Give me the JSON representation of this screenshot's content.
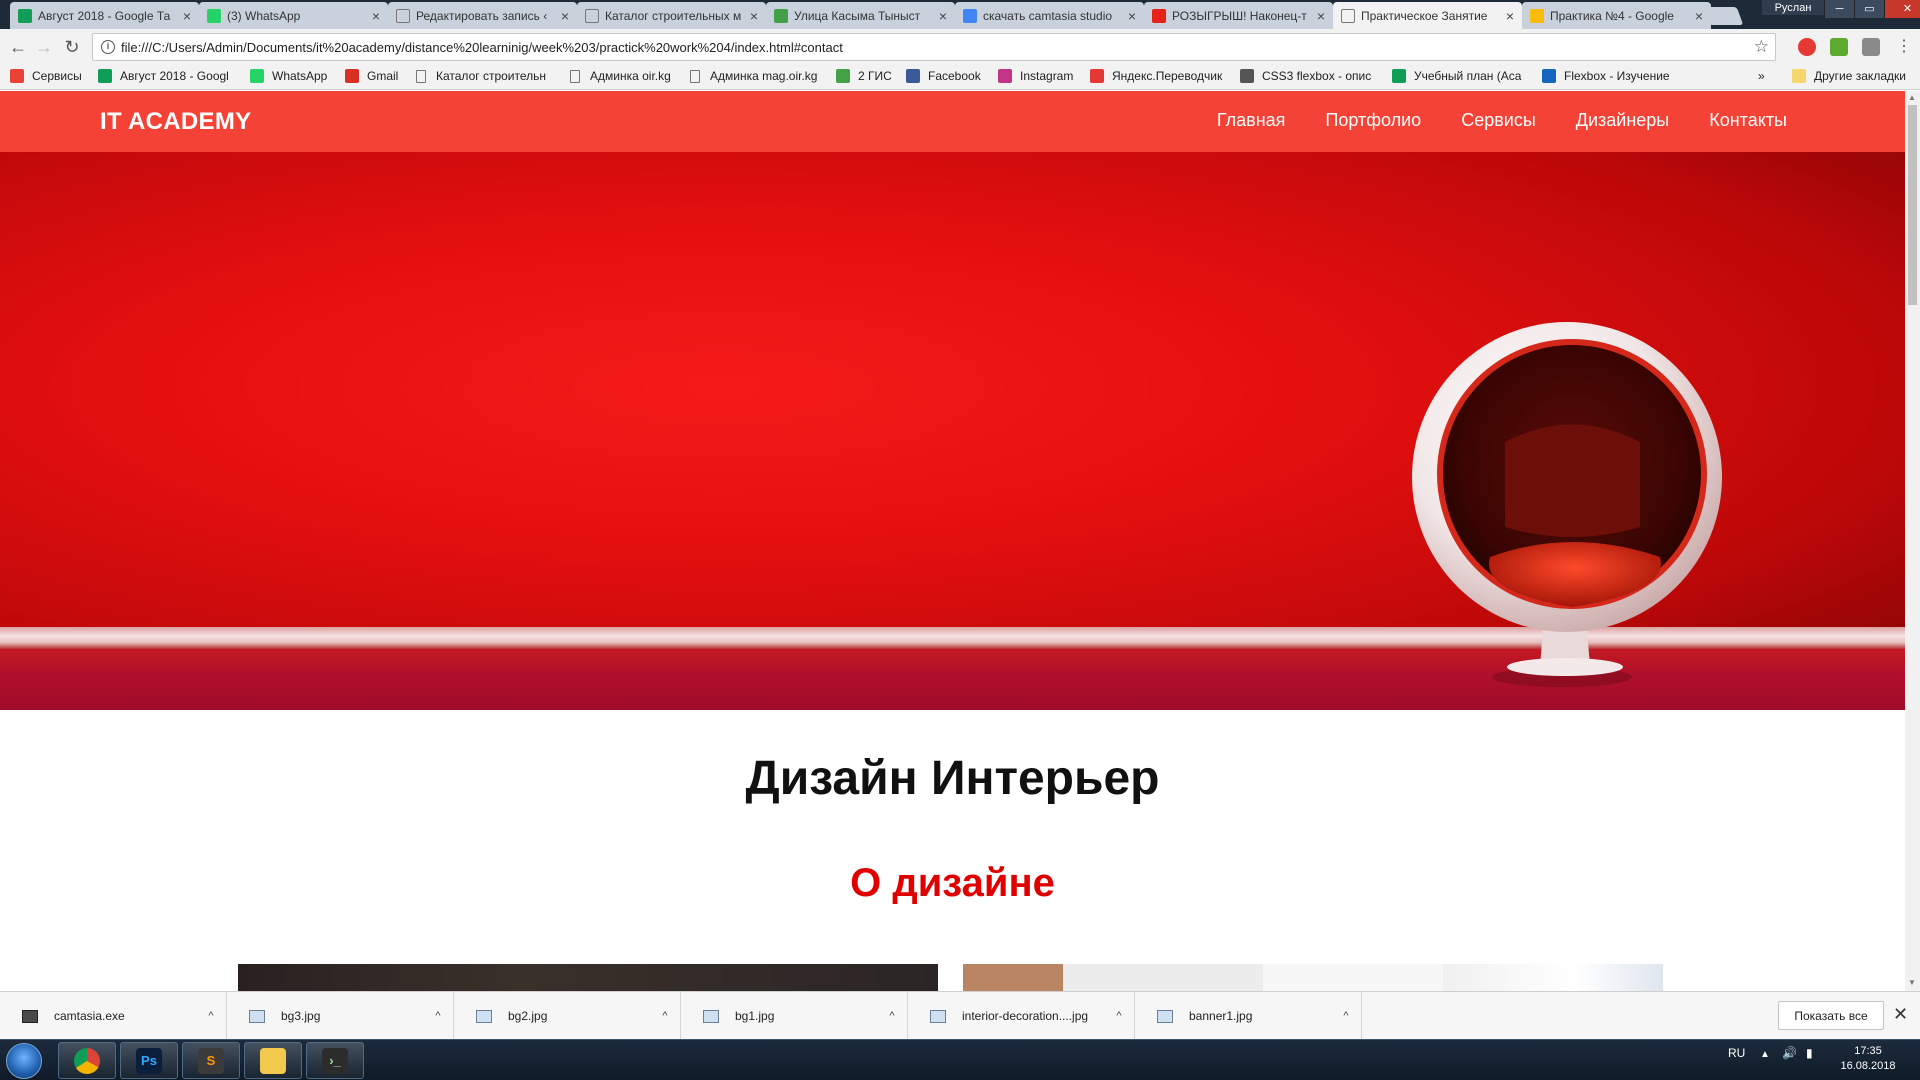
{
  "tabs": [
    {
      "title": "Август 2018 - Google Та",
      "icon": "sheets-icon",
      "color": "#0f9d58"
    },
    {
      "title": "(3) WhatsApp",
      "icon": "whatsapp-icon",
      "color": "#25d366"
    },
    {
      "title": "Редактировать запись ‹",
      "icon": "page-icon",
      "color": ""
    },
    {
      "title": "Каталог строительных м",
      "icon": "page-icon",
      "color": ""
    },
    {
      "title": "Улица Касыма Тыныст",
      "icon": "2gis-icon",
      "color": "#43a047"
    },
    {
      "title": "скачать camtasia studio",
      "icon": "google-icon",
      "color": "#4285f4"
    },
    {
      "title": "РОЗЫГРЫШ! Наконец-т",
      "icon": "youtube-icon",
      "color": "#e62117"
    },
    {
      "title": "Практическое Занятие",
      "icon": "page-icon",
      "color": "",
      "active": true
    },
    {
      "title": "Практика №4 - Google",
      "icon": "drive-icon",
      "color": "#fbbc05"
    }
  ],
  "window": {
    "user": "Руслан"
  },
  "address": {
    "url": "file:///C:/Users/Admin/Documents/it%20academy/distance%20learninig/week%203/practick%20work%204/index.html#contact"
  },
  "bookmarks": [
    {
      "label": "Сервисы",
      "icon": "apps-icon",
      "color": "#e94235"
    },
    {
      "label": "Август 2018 - Googl",
      "icon": "sheets-icon",
      "color": "#0f9d58"
    },
    {
      "label": "WhatsApp",
      "icon": "whatsapp-icon",
      "color": "#25d366"
    },
    {
      "label": "Gmail",
      "icon": "gmail-icon",
      "color": "#d93025"
    },
    {
      "label": "Каталог строительн",
      "icon": "page-icon",
      "color": ""
    },
    {
      "label": "Админка oir.kg",
      "icon": "page-icon",
      "color": ""
    },
    {
      "label": "Админка mag.oir.kg",
      "icon": "page-icon",
      "color": ""
    },
    {
      "label": "2 ГИС",
      "icon": "2gis-icon",
      "color": "#43a047"
    },
    {
      "label": "Facebook",
      "icon": "facebook-icon",
      "color": "#3b5998"
    },
    {
      "label": "Instagram",
      "icon": "instagram-icon",
      "color": "#c13584"
    },
    {
      "label": "Яндекс.Переводчик",
      "icon": "yandex-translate-icon",
      "color": "#e53935"
    },
    {
      "label": "CSS3 flexbox - опис",
      "icon": "htmlbook-icon",
      "color": "#555555"
    },
    {
      "label": "Учебный план (Aca",
      "icon": "sheets-icon",
      "color": "#0f9d58"
    },
    {
      "label": "Flexbox - Изучение",
      "icon": "flexbox-icon",
      "color": "#1565c0"
    }
  ],
  "bookmarks_more": "»",
  "other_bookmarks": "Другие закладки",
  "site": {
    "logo": "IT ACADEMY",
    "nav": [
      "Главная",
      "Портфолио",
      "Сервисы",
      "Дизайнеры",
      "Контакты"
    ],
    "heading": "Дизайн Интерьер",
    "subheading": "О дизайне",
    "accent": "#f44336"
  },
  "downloads": {
    "files": [
      "camtasia.exe",
      "bg3.jpg",
      "bg2.jpg",
      "bg1.jpg",
      "interior-decoration....jpg",
      "banner1.jpg"
    ],
    "show_all": "Показать все"
  },
  "taskbar": {
    "apps": [
      "chrome-icon",
      "photoshop-icon",
      "sublime-text-icon",
      "file-explorer-icon",
      "terminal-icon"
    ],
    "language": "RU",
    "time": "17:35",
    "date": "16.08.2018"
  }
}
